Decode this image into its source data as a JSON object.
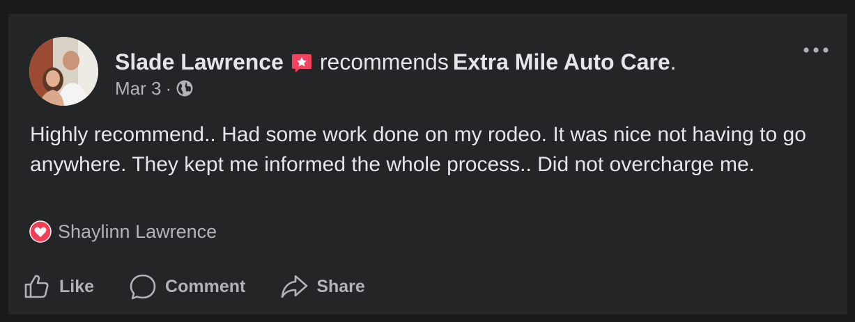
{
  "post": {
    "author": "Slade Lawrence",
    "verb": "recommends",
    "page_name": "Extra Mile Auto Care",
    "page_suffix": ".",
    "date": "Mar 3",
    "separator": "·",
    "privacy_icon": "globe-icon",
    "body": "Highly recommend.. Had some work done on my rodeo. It was nice not having to go anywhere. They kept me informed the whole process.. Did not overcharge me.",
    "reaction_icon": "love-reaction-icon",
    "reaction_by": "Shaylinn Lawrence",
    "more_icon": "more-options-icon"
  },
  "actions": {
    "like": "Like",
    "comment": "Comment",
    "share": "Share"
  },
  "colors": {
    "page_background": "#18191a",
    "card_background": "#242526",
    "primary_text": "#e4e6eb",
    "secondary_text": "#b0b3b8",
    "recommend_badge": "#f3425f",
    "love_reaction": "#f33e58"
  }
}
